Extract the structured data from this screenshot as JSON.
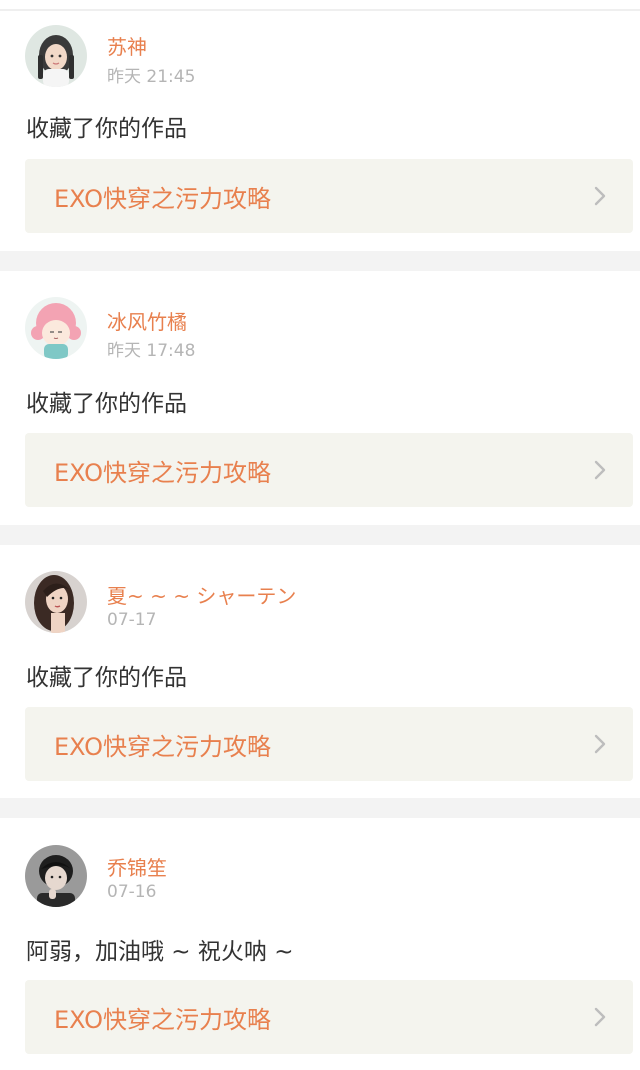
{
  "feed": {
    "items": [
      {
        "username": "苏神",
        "time": "昨天 21:45",
        "message": "收藏了你的作品",
        "work_title": "EXO快穿之污力攻略",
        "avatar_icon": "girl-braids-avatar"
      },
      {
        "username": "冰风竹橘",
        "time": "昨天 17:48",
        "message": "收藏了你的作品",
        "work_title": "EXO快穿之污力攻略",
        "avatar_icon": "pink-hair-cartoon-avatar"
      },
      {
        "username": "夏~ ~ ~ シャーテン",
        "time": "07-17",
        "message": "收藏了你的作品",
        "work_title": "EXO快穿之污力攻略",
        "avatar_icon": "long-hair-woman-avatar"
      },
      {
        "username": "乔锦笙",
        "time": "07-16",
        "message": "阿弱，加油哦 ~ 祝火呐 ~",
        "work_title": "EXO快穿之污力攻略",
        "avatar_icon": "dark-hair-boy-avatar"
      }
    ]
  },
  "colors": {
    "accent": "#e8804e",
    "muted": "#b5b5b5",
    "text": "#333333",
    "link_bg": "#f4f4ee",
    "separator": "#f3f3f3"
  }
}
